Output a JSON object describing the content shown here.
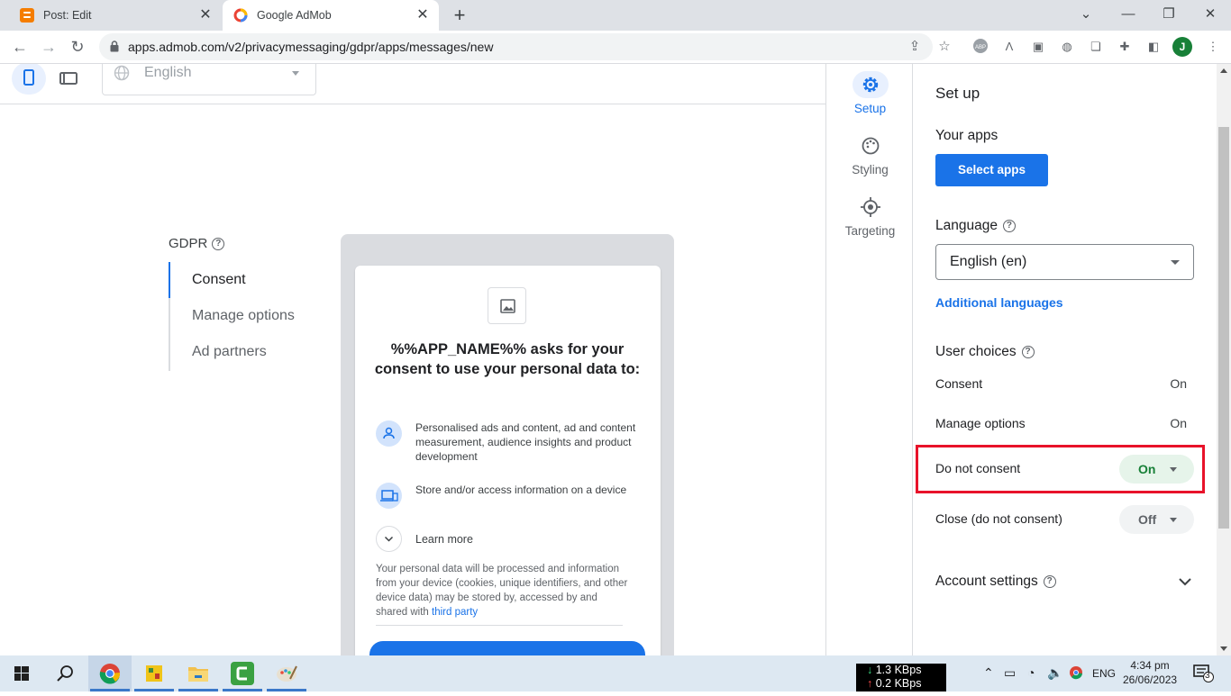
{
  "browser": {
    "tabs": [
      {
        "title": "Post: Edit",
        "favicon": "blogger-icon",
        "active": false
      },
      {
        "title": "Google AdMob",
        "favicon": "admob-icon",
        "active": true
      }
    ],
    "url": "apps.admob.com/v2/privacymessaging/gdpr/apps/messages/new",
    "profile_initial": "J"
  },
  "preview_toolbar": {
    "language": "English"
  },
  "gdpr_nav": {
    "title": "GDPR",
    "items": [
      "Consent",
      "Manage options",
      "Ad partners"
    ],
    "active_index": 0
  },
  "consent_preview": {
    "title": "%%APP_NAME%% asks for your consent to use your personal data to:",
    "purposes": [
      {
        "icon": "person-icon",
        "text": "Personalised ads and content, ad and content measurement, audience insights and product development"
      },
      {
        "icon": "devices-icon",
        "text": "Store and/or access information on a device"
      }
    ],
    "learn_more": "Learn more",
    "disclaimer_text": "Your personal data will be processed and information from your device (cookies, unique identifiers, and other device data) may be stored by, accessed by and shared with ",
    "disclaimer_link": "third party"
  },
  "rail": {
    "items": [
      {
        "label": "Setup",
        "icon": "gear-icon",
        "active": true
      },
      {
        "label": "Styling",
        "icon": "palette-icon",
        "active": false
      },
      {
        "label": "Targeting",
        "icon": "target-icon",
        "active": false
      }
    ]
  },
  "panel": {
    "title": "Set up",
    "your_apps": {
      "heading": "Your apps",
      "button": "Select apps"
    },
    "language": {
      "heading": "Language",
      "value": "English (en)",
      "additional": "Additional languages"
    },
    "user_choices": {
      "heading": "User choices",
      "rows": [
        {
          "label": "Consent",
          "value": "On"
        },
        {
          "label": "Manage options",
          "value": "On"
        },
        {
          "label": "Do not consent",
          "value": "On"
        },
        {
          "label": "Close (do not consent)",
          "value": "Off"
        }
      ]
    },
    "account_settings": "Account settings"
  },
  "taskbar": {
    "net_down": "1.3 KBps",
    "net_up": "0.2 KBps",
    "lang": "ENG",
    "time": "4:34 pm",
    "date": "26/06/2023",
    "notif_count": "3"
  },
  "colors": {
    "accent": "#1a73e8",
    "on_green": "#188038",
    "highlight_red": "#e8132a"
  }
}
